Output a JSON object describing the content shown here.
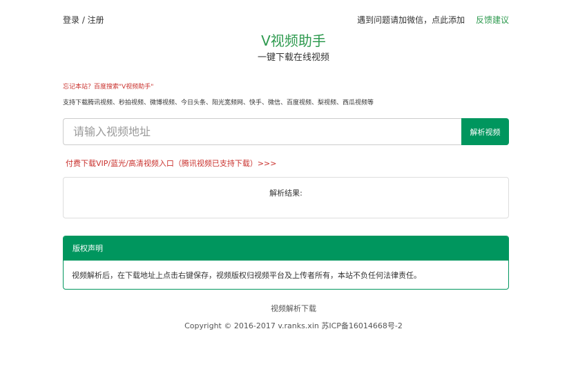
{
  "topbar": {
    "login_label": "登录 / 注册",
    "notice": "遇到问题请加微信，点此添加",
    "feedback_label": "反馈建议"
  },
  "header": {
    "title": "V视频助手",
    "subtitle": "一键下载在线视频"
  },
  "hint": "忘记本站？百度搜索\"V视频助手\"",
  "supported_sites": "支持下载腾讯视频、秒拍视频、微博视频、今日头条、阳光宽频网、快手、微信、百度视频、梨视频、西瓜视频等",
  "search": {
    "placeholder": "请输入视频地址",
    "value": "",
    "button_label": "解析视频"
  },
  "vip_link": "付费下载VIP/蓝光/高清视频入口（腾讯视频已支持下载）>>>",
  "result": {
    "label": "解析结果:"
  },
  "copyright_panel": {
    "heading": "版权声明",
    "body": "视频解析后，在下载地址上点击右键保存，视频版权归视频平台及上传者所有，本站不负任何法律责任。"
  },
  "footer": {
    "link": "视频解析下载",
    "copyright": "Copyright © 2016-2017 v.ranks.xin 苏ICP备16014668号-2"
  },
  "colors": {
    "brand_green": "#00965e",
    "title_green": "#2e9a4f",
    "alert_red": "#c9302c"
  }
}
